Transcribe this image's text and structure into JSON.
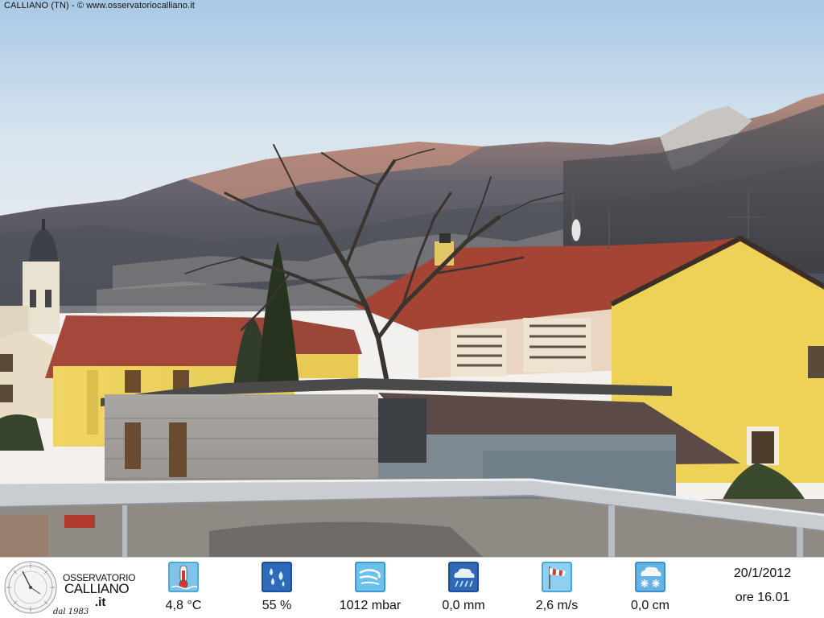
{
  "caption": "CALLIANO (TN) - © www.osservatoriocalliano.it",
  "logo": {
    "line1": "OSSERVATORIO",
    "line2": "CALLIANO",
    "line3": ".it",
    "line4": "dal 1983"
  },
  "readings": [
    {
      "icon": "thermometer-icon",
      "value": "4,8 °C"
    },
    {
      "icon": "humidity-drops-icon",
      "value": "55 %"
    },
    {
      "icon": "pressure-wind-icon",
      "value": "1012 mbar"
    },
    {
      "icon": "rain-cloud-icon",
      "value": "0,0 mm"
    },
    {
      "icon": "windsock-icon",
      "value": "2,6 m/s"
    },
    {
      "icon": "snow-cloud-icon",
      "value": "0,0 cm"
    }
  ],
  "date": "20/1/2012",
  "time": "ore 16.01",
  "colors": {
    "sky_top": "#8fb7df",
    "sky_bottom": "#f2f1f0",
    "roof": "#a4483a",
    "house_yellow": "#e8cf5a"
  }
}
